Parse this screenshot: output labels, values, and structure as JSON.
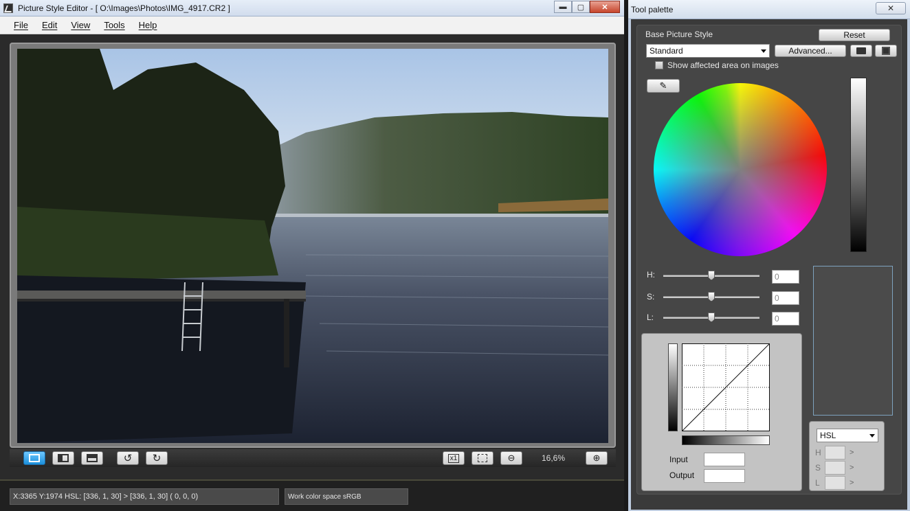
{
  "main_window": {
    "title": "Picture Style Editor - [ O:\\Images\\Photos\\IMG_4917.CR2 ]",
    "window_buttons": {
      "minimize": "▬",
      "maximize": "▢",
      "close": "✕"
    },
    "menu": [
      "File",
      "Edit",
      "View",
      "Tools",
      "Help"
    ]
  },
  "viewer_toolbar": {
    "view_buttons": [
      "single-view-icon",
      "side-by-side-view-icon",
      "split-view-icon"
    ],
    "rotate_buttons": [
      "rotate-left-icon",
      "rotate-right-icon"
    ],
    "zoom_100_label": "x1",
    "zoom_level": "16,6%"
  },
  "status_bar": {
    "pixel_info": "X:3365 Y:1974  HSL: [336,  1, 30] > [336,  1, 30]  (  0,  0,  0)",
    "color_space": "Work color space  sRGB"
  },
  "palette": {
    "title": "Tool palette",
    "close_label": "✕",
    "base_style_label": "Base Picture Style",
    "reset_label": "Reset",
    "base_style_value": "Standard",
    "advanced_label": "Advanced...",
    "show_affected_label": "Show affected area on images",
    "show_affected_checked": false,
    "h_label": "H:",
    "s_label": "S:",
    "l_label": "L:",
    "h_value": "0",
    "s_value": "0",
    "l_value": "0",
    "h_level": 0.5,
    "s_level": 0.5,
    "l_level": 0.5,
    "input_label": "Input",
    "output_label": "Output",
    "mode_value": "HSL",
    "mode_rows": [
      "H",
      "S",
      "L"
    ],
    "mode_arrow": ">"
  },
  "colors": {
    "accent_blue": "#1b8fdb",
    "panel_dark": "#464646",
    "titlebar": "#d1dced"
  }
}
